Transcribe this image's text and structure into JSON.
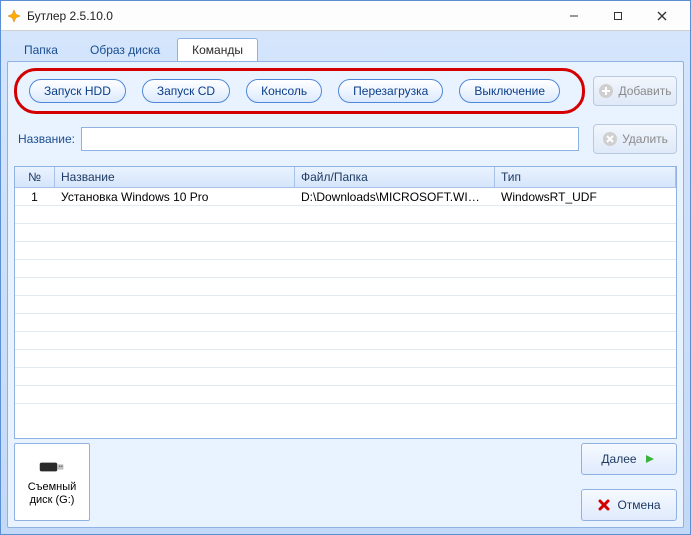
{
  "window": {
    "title": "Бутлер 2.5.10.0"
  },
  "tabs": {
    "folder": {
      "label": "Папка"
    },
    "image": {
      "label": "Образ диска"
    },
    "commands": {
      "label": "Команды",
      "active": true
    }
  },
  "commands": {
    "hdd": "Запуск HDD",
    "cd": "Запуск CD",
    "console": "Консоль",
    "reboot": "Перезагрузка",
    "shutdown": "Выключение"
  },
  "side": {
    "add": "Добавить",
    "delete": "Удалить"
  },
  "name": {
    "label": "Название:",
    "value": ""
  },
  "table": {
    "headers": {
      "num": "№",
      "name": "Название",
      "path": "Файл/Папка",
      "type": "Тип"
    },
    "rows": [
      {
        "num": "1",
        "name": "Установка Windows 10 Pro",
        "path": "D:\\Downloads\\MICROSOFT.WINDO...",
        "type": "WindowsRT_UDF"
      }
    ]
  },
  "device": {
    "line1": "Съемный",
    "line2": "диск (G:)"
  },
  "nav": {
    "next": "Далее",
    "cancel": "Отмена"
  }
}
